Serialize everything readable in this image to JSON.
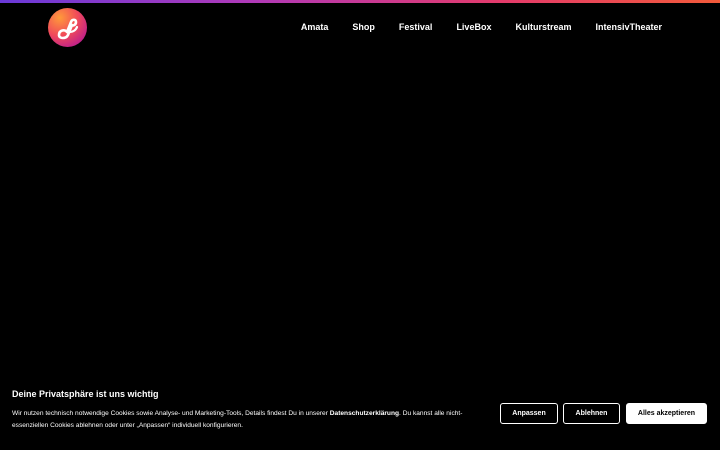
{
  "header": {
    "logo_icon": "music-note-logo-icon",
    "nav_items": [
      {
        "label": "Amata"
      },
      {
        "label": "Shop"
      },
      {
        "label": "Festival"
      },
      {
        "label": "LiveBox"
      },
      {
        "label": "Kulturstream"
      },
      {
        "label": "IntensivTheater"
      }
    ]
  },
  "cookie_banner": {
    "title": "Deine Privatsphäre ist uns wichtig",
    "text_part1": "Wir nutzen technisch notwendige Cookies sowie Analyse- und Marketing-Tools, Details findest Du in unserer ",
    "privacy_link": "Datenschutzerklärung",
    "text_part2": ". Du kannst alle nicht-essenziellen Cookies ablehnen oder unter „Anpassen“ individuell konfigurieren.",
    "buttons": {
      "customize": "Anpassen",
      "decline": "Ablehnen",
      "accept_all": "Alles akzeptieren"
    }
  },
  "colors": {
    "background": "#000000",
    "text": "#ffffff",
    "accent_gradient_start": "#6a3ad8",
    "accent_gradient_end": "#f25a3a"
  }
}
